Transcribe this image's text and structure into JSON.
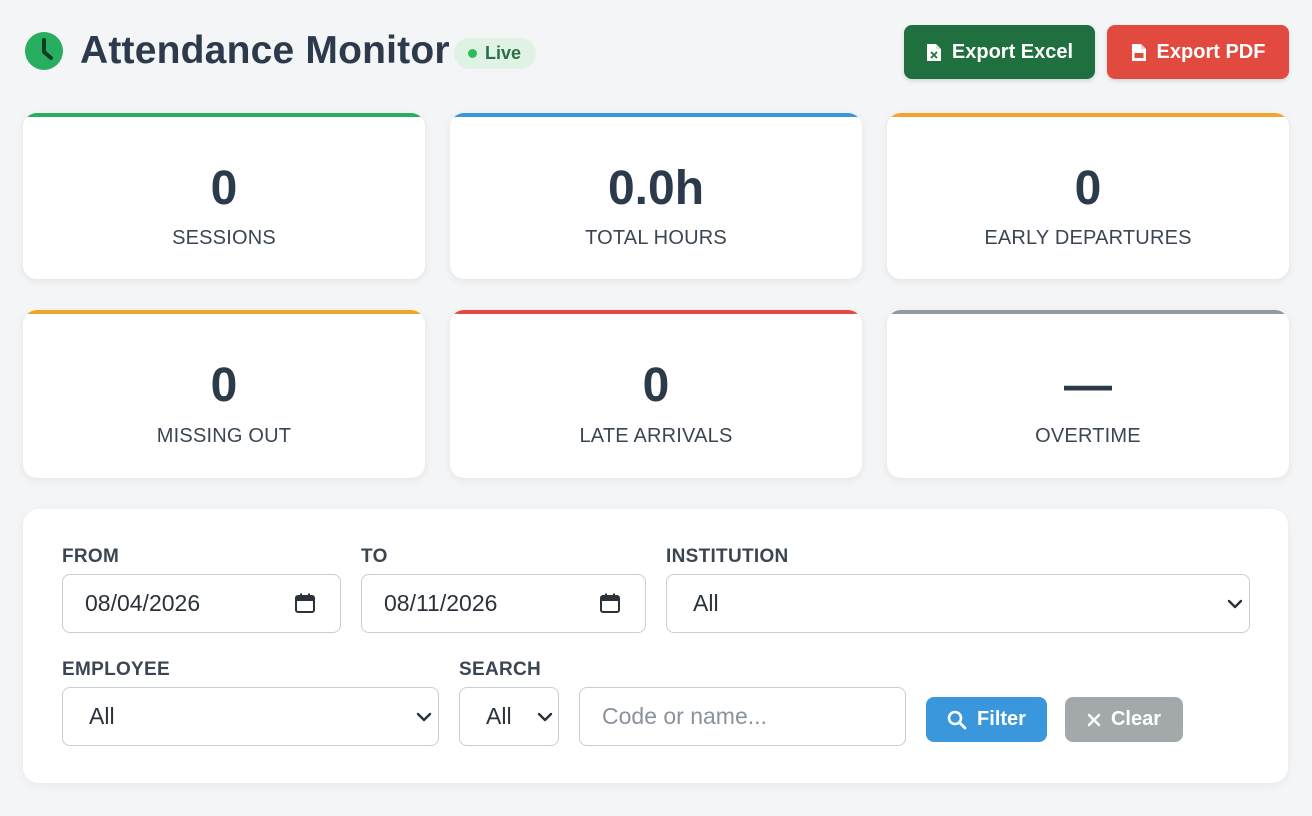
{
  "header": {
    "title": "Attendance Monitor",
    "live_label": "Live",
    "clock_icon": "clock-icon",
    "accent_color": "#27ae60"
  },
  "actions": {
    "export_excel": {
      "label": "Export Excel",
      "icon": "excel-file-icon",
      "color": "#1f6f3f"
    },
    "export_pdf": {
      "label": "Export PDF",
      "icon": "pdf-file-icon",
      "color": "#e24a40"
    }
  },
  "stats": [
    {
      "value": "0",
      "label": "SESSIONS",
      "accent": "#27ae60"
    },
    {
      "value": "0.0h",
      "label": "TOTAL HOURS",
      "accent": "#3a97dc"
    },
    {
      "value": "0",
      "label": "EARLY DEPARTURES",
      "accent": "#f0a62a"
    },
    {
      "value": "0",
      "label": "MISSING OUT",
      "accent": "#f0a62a"
    },
    {
      "value": "0",
      "label": "LATE ARRIVALS",
      "accent": "#e24a40"
    },
    {
      "value": "—",
      "label": "OVERTIME",
      "accent": "#8f9aa0"
    }
  ],
  "filters": {
    "from": {
      "label": "FROM",
      "value": "08/04/2026"
    },
    "to": {
      "label": "TO",
      "value": "08/11/2026"
    },
    "institution": {
      "label": "INSTITUTION",
      "value": "All"
    },
    "employee": {
      "label": "EMPLOYEE",
      "value": "All"
    },
    "search": {
      "label": "SEARCH",
      "scope": "All",
      "placeholder": "Code or name..."
    },
    "filter_button": "Filter",
    "clear_button": "Clear"
  }
}
